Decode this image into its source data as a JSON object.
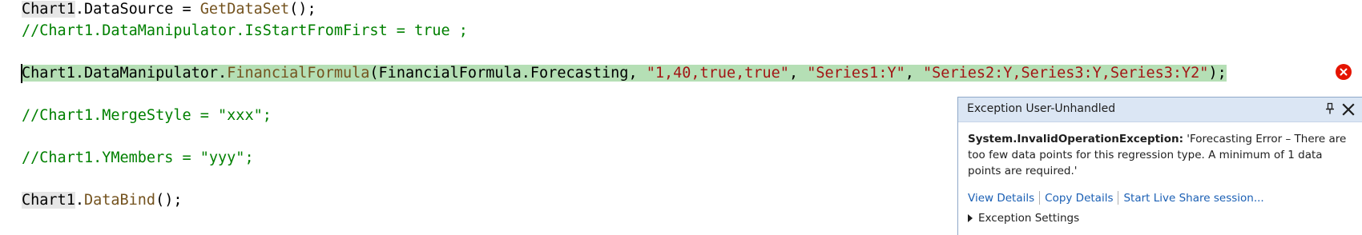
{
  "code": {
    "line1": {
      "chart": "Chart1",
      "dot": ".",
      "prop": "DataSource",
      "assign": " = ",
      "method": "GetDataSet",
      "tail": "();"
    },
    "line2": {
      "comment": "//Chart1.DataManipulator.IsStartFromFirst = true ;"
    },
    "line3": {
      "chart": "Chart1",
      "dot1": ".",
      "prop": "DataManipulator",
      "dot2": ".",
      "method": "FinancialFormula",
      "open": "(",
      "enum_type": "FinancialFormula",
      "dot3": ".",
      "enum_value": "Forecasting",
      "sep1": ", ",
      "arg1": "\"1,40,true,true\"",
      "sep2": ", ",
      "arg2": "\"Series1:Y\"",
      "sep3": ", ",
      "arg3": "\"Series2:Y,Series3:Y,Series3:Y2\"",
      "close": ");"
    },
    "line4": {
      "comment": "//Chart1.MergeStyle = \"xxx\";"
    },
    "line5": {
      "comment": "//Chart1.YMembers = \"yyy\";"
    },
    "line6": {
      "chart": "Chart1",
      "dot": ".",
      "method": "DataBind",
      "tail": "();"
    }
  },
  "exception_popup": {
    "title": "Exception User-Unhandled",
    "exception_type": "System.InvalidOperationException:",
    "message": " 'Forecasting Error – There are too few data points for this regression type. A minimum of 1 data points are required.'",
    "links": {
      "view_details": "View Details",
      "copy_details": "Copy Details",
      "live_share": "Start Live Share session..."
    },
    "settings_label": "Exception Settings"
  },
  "icons": {
    "error_glyph": "error-circle-icon",
    "pin": "pin-icon",
    "close": "close-icon"
  },
  "colors": {
    "comment": "#008000",
    "string": "#a31515",
    "method": "#74531f",
    "exec_highlight": "#b5dfb5",
    "error": "#e51400",
    "link": "#1a5fb4",
    "popup_header": "#dbe6f4"
  }
}
